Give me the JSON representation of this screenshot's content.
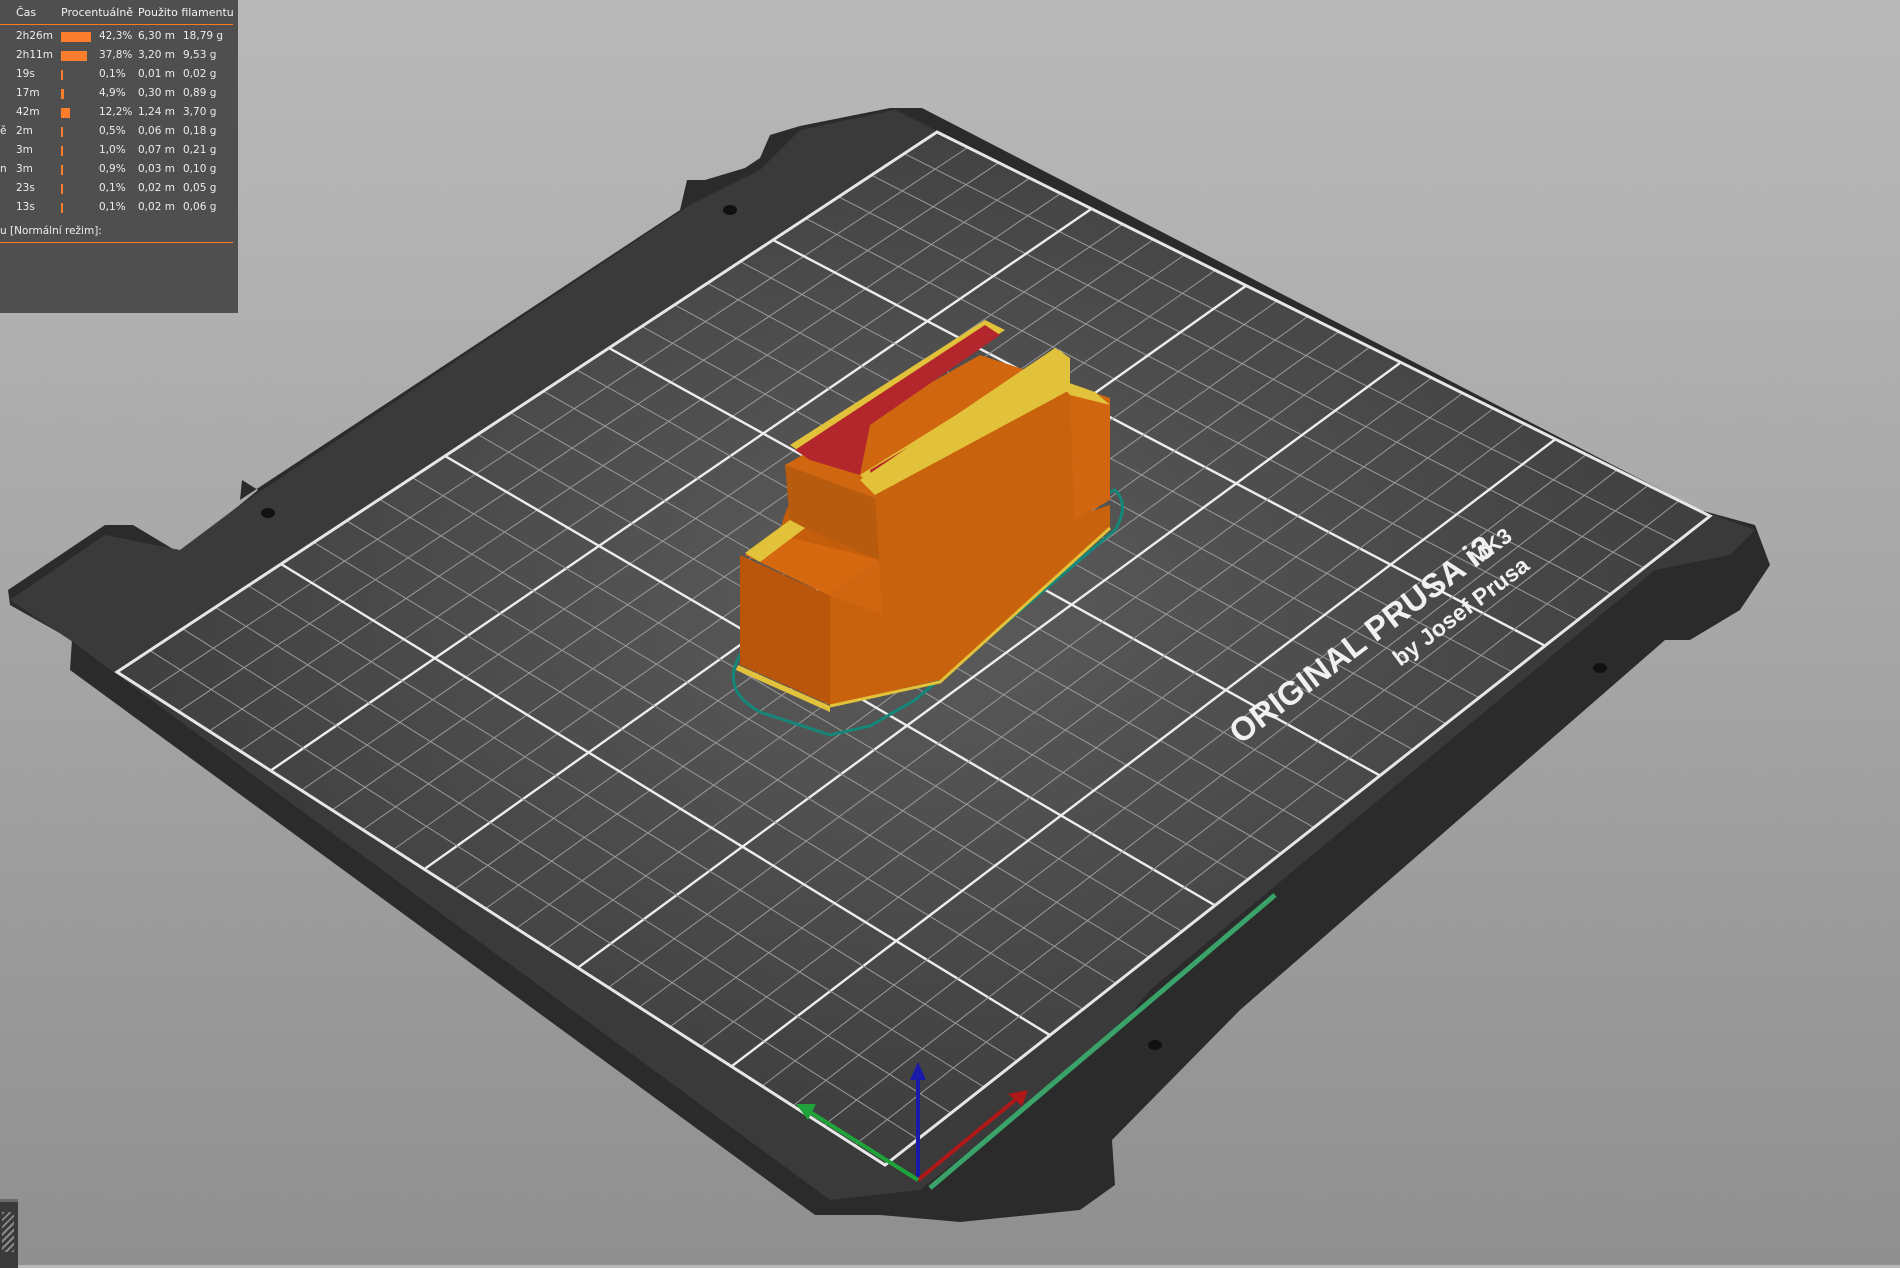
{
  "stats": {
    "headers": {
      "time": "Čas",
      "percent": "Procentuálně",
      "filament": "Použito filamentu"
    },
    "rows": [
      {
        "label": "",
        "time": "2h26m",
        "percent": "42,3%",
        "share": 0.423,
        "length": "6,30 m",
        "weight": "18,79 g"
      },
      {
        "label": "",
        "time": "2h11m",
        "percent": "37,8%",
        "share": 0.378,
        "length": "3,20 m",
        "weight": "9,53 g"
      },
      {
        "label": "",
        "time": "19s",
        "percent": "0,1%",
        "share": 0.001,
        "length": "0,01 m",
        "weight": "0,02 g"
      },
      {
        "label": "",
        "time": "17m",
        "percent": "4,9%",
        "share": 0.049,
        "length": "0,30 m",
        "weight": "0,89 g"
      },
      {
        "label": "",
        "time": "42m",
        "percent": "12,2%",
        "share": 0.122,
        "length": "1,24 m",
        "weight": "3,70 g"
      },
      {
        "label": "ě",
        "time": "2m",
        "percent": "0,5%",
        "share": 0.005,
        "length": "0,06 m",
        "weight": "0,18 g"
      },
      {
        "label": "",
        "time": "3m",
        "percent": "1,0%",
        "share": 0.01,
        "length": "0,07 m",
        "weight": "0,21 g"
      },
      {
        "label": "n",
        "time": "3m",
        "percent": "0,9%",
        "share": 0.009,
        "length": "0,03 m",
        "weight": "0,10 g"
      },
      {
        "label": "",
        "time": "23s",
        "percent": "0,1%",
        "share": 0.001,
        "length": "0,02 m",
        "weight": "0,05 g"
      },
      {
        "label": "",
        "time": "13s",
        "percent": "0,1%",
        "share": 0.001,
        "length": "0,02 m",
        "weight": "0,06 g"
      }
    ],
    "footer": "u [Normální režim]:"
  },
  "bed": {
    "brand_line1": "ORIGINAL PRUSA i3",
    "brand_model": "MK3",
    "brand_line2": "by Josef Prusa"
  },
  "colors": {
    "bed": "#333333",
    "grid": "#e6e6e6",
    "model": "#d6680f",
    "top_infill": "#b3262b",
    "perimeter": "#e2c23a",
    "skirt": "#14877a",
    "axis_x": "#b01818",
    "axis_y": "#1fa33a",
    "axis_z": "#1a1aa8"
  }
}
